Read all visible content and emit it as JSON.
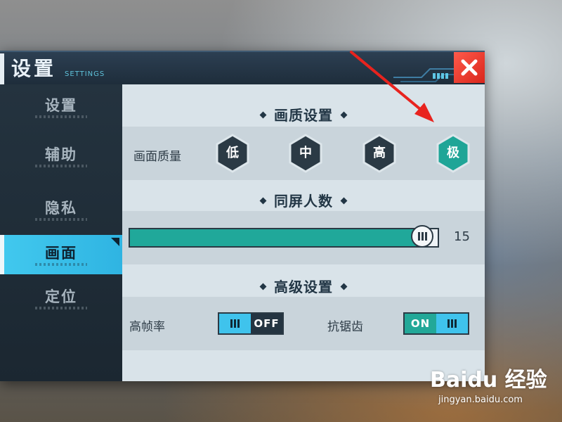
{
  "window": {
    "title": "设置",
    "subtitle": "SETTINGS",
    "close_label": "close"
  },
  "sidebar": {
    "items": [
      {
        "label": "设置",
        "active": false
      },
      {
        "label": "辅助",
        "active": false
      },
      {
        "label": "隐私",
        "active": false
      },
      {
        "label": "画面",
        "active": true
      },
      {
        "label": "定位",
        "active": false
      }
    ]
  },
  "quality": {
    "section_title": "画质设置",
    "label": "画面质量",
    "options": [
      {
        "label": "低",
        "selected": false
      },
      {
        "label": "中",
        "selected": false
      },
      {
        "label": "高",
        "selected": false
      },
      {
        "label": "极",
        "selected": true
      }
    ]
  },
  "players": {
    "section_title": "同屏人数",
    "value": "15",
    "fraction": 0.95
  },
  "advanced": {
    "section_title": "高级设置",
    "high_fps": {
      "label": "高帧率",
      "state": "OFF"
    },
    "antialias": {
      "label": "抗锯齿",
      "state": "ON"
    }
  },
  "watermark": {
    "brand": "Baidu 经验",
    "url": "jingyan.baidu.com"
  },
  "colors": {
    "accent_teal": "#20a89a",
    "accent_blue": "#3fc3ec",
    "close_red": "#e03a2c",
    "arrow_red": "#e8231e"
  }
}
